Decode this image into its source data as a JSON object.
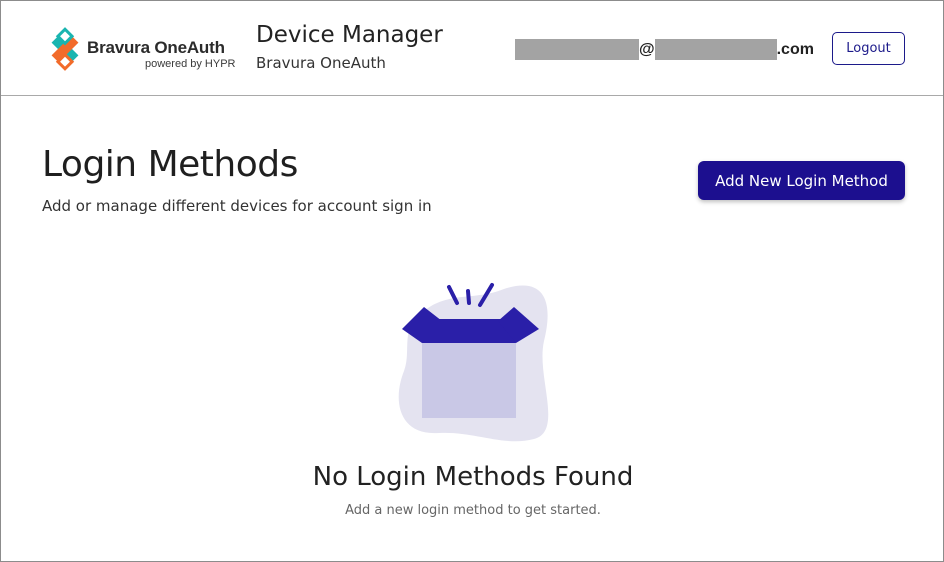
{
  "header": {
    "logo": {
      "name": "Bravura OneAuth",
      "tagline": "powered by HYPR",
      "colors": {
        "teal": "#1ab5b0",
        "orange": "#f26b2a"
      }
    },
    "app_title": "Device Manager",
    "app_subtitle": "Bravura OneAuth",
    "user_email": {
      "at": "@",
      "domain_suffix": ".com"
    },
    "logout_label": "Logout"
  },
  "main": {
    "title": "Login Methods",
    "subtitle": "Add or manage different devices for account sign in",
    "add_button_label": "Add New Login Method",
    "empty_state": {
      "icon": "open-box-icon",
      "title": "No Login Methods Found",
      "message": "Add a new login method to get started."
    }
  },
  "colors": {
    "primary": "#1c0f8f",
    "box_dark": "#2a1fa8",
    "box_light": "#c9c8e6",
    "blob": "#e4e3f0",
    "header_border": "#a9a9a9"
  }
}
